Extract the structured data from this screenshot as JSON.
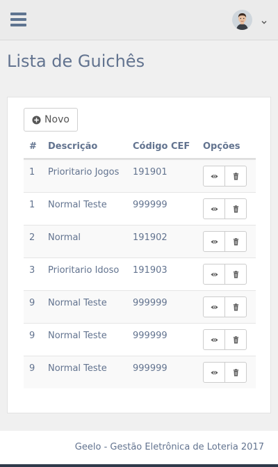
{
  "header": {
    "menu_icon": "hamburger-icon",
    "avatar_icon": "user-avatar",
    "dropdown_icon": "chevron-down-icon"
  },
  "page": {
    "title": "Lista de Guichês"
  },
  "toolbar": {
    "novo_label": "Novo",
    "novo_icon": "plus-circle-icon"
  },
  "table": {
    "columns": [
      "#",
      "Descrição",
      "Código CEF",
      "Opções"
    ],
    "rows": [
      {
        "num": "1",
        "descricao": "Prioritario Jogos",
        "codigo_cef": "191901"
      },
      {
        "num": "1",
        "descricao": "Normal Teste",
        "codigo_cef": "999999"
      },
      {
        "num": "2",
        "descricao": "Normal",
        "codigo_cef": "191902"
      },
      {
        "num": "3",
        "descricao": "Prioritario Idoso",
        "codigo_cef": "191903"
      },
      {
        "num": "9",
        "descricao": "Normal Teste",
        "codigo_cef": "999999"
      },
      {
        "num": "9",
        "descricao": "Normal Teste",
        "codigo_cef": "999999"
      },
      {
        "num": "9",
        "descricao": "Normal Teste",
        "codigo_cef": "999999"
      }
    ],
    "row_actions": [
      "eye-icon",
      "trash-icon"
    ]
  },
  "footer": {
    "text": "Geelo - Gestão Eletrônica de Loteria 2017"
  },
  "colors": {
    "text": "#62738f",
    "topbar": "#ebebeb",
    "background": "#f0f0f0",
    "stripe": "#f9f9f9"
  }
}
